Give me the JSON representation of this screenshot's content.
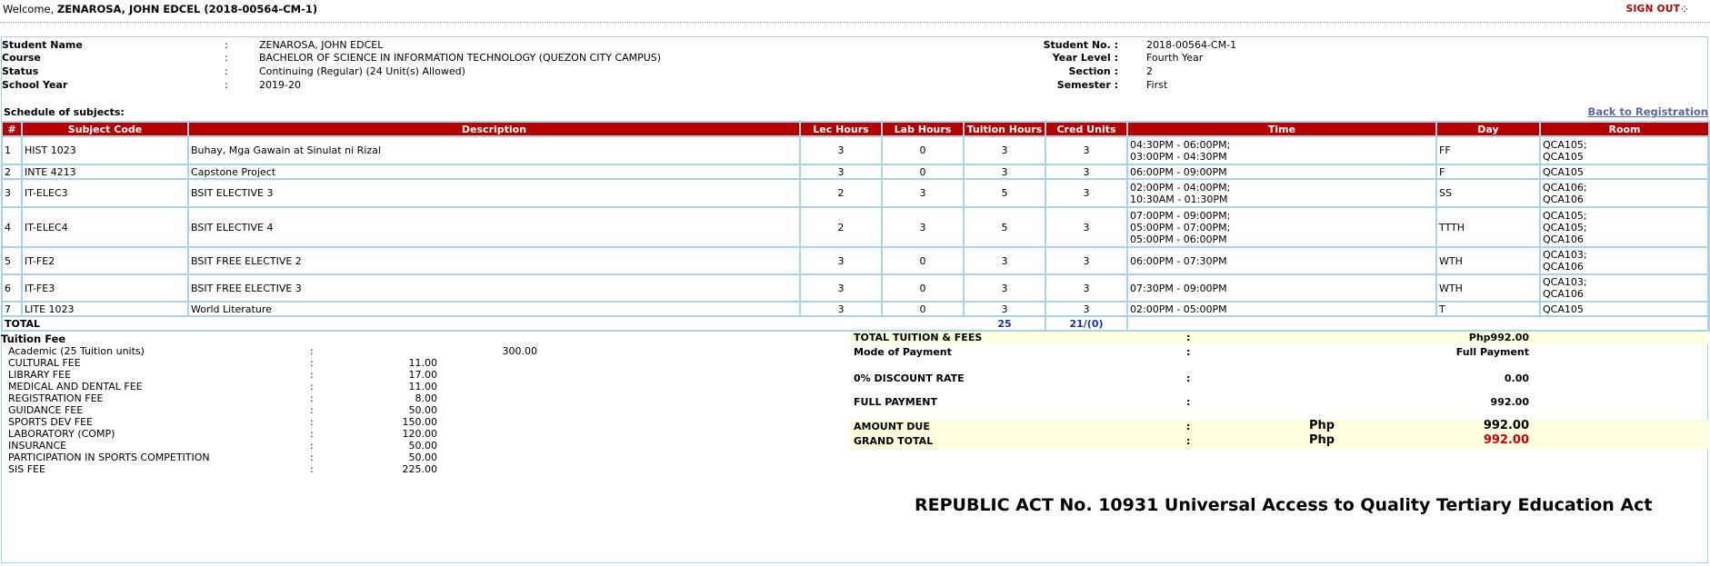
{
  "header": {
    "welcome_prefix": "Welcome, ",
    "welcome_user": "ZENAROSA, JOHN EDCEL (2018-00564-CM-1)",
    "signout_label": "SIGN OUT"
  },
  "student": {
    "left": [
      {
        "label": "Student Name",
        "value": "ZENAROSA, JOHN EDCEL"
      },
      {
        "label": "Course",
        "value": "BACHELOR OF SCIENCE IN INFORMATION TECHNOLOGY (QUEZON CITY CAMPUS)"
      },
      {
        "label": "Status",
        "value": "Continuing (Regular) (24 Unit(s) Allowed)"
      },
      {
        "label": "School Year",
        "value": "2019-20"
      }
    ],
    "right": [
      {
        "label": "Student No. :",
        "value": "2018-00564-CM-1"
      },
      {
        "label": "Year Level :",
        "value": "Fourth Year"
      },
      {
        "label": "Section :",
        "value": "2"
      },
      {
        "label": "Semester :",
        "value": "First"
      }
    ],
    "colon": ":"
  },
  "schedule": {
    "label": "Schedule of subjects:",
    "back_link": "Back to Registration",
    "headers": [
      "#",
      "Subject Code",
      "Description",
      "Lec Hours",
      "Lab Hours",
      "Tuition Hours",
      "Cred Units",
      "Time",
      "Day",
      "Room"
    ],
    "rows": [
      {
        "num": "1",
        "code": "HIST 1023",
        "desc": "Buhay, Mga Gawain at Sinulat ni Rizal",
        "lec": "3",
        "lab": "0",
        "tuition": "3",
        "cred": "3",
        "time": "04:30PM - 06:00PM;\n03:00PM - 04:30PM",
        "day": "FF",
        "room": "QCA105;\nQCA105"
      },
      {
        "num": "2",
        "code": "INTE 4213",
        "desc": "Capstone Project",
        "lec": "3",
        "lab": "0",
        "tuition": "3",
        "cred": "3",
        "time": "06:00PM - 09:00PM",
        "day": "F",
        "room": "QCA105"
      },
      {
        "num": "3",
        "code": "IT-ELEC3",
        "desc": "BSIT ELECTIVE 3",
        "lec": "2",
        "lab": "3",
        "tuition": "5",
        "cred": "3",
        "time": "02:00PM - 04:00PM;\n10:30AM - 01:30PM",
        "day": "SS",
        "room": "QCA106;\nQCA106"
      },
      {
        "num": "4",
        "code": "IT-ELEC4",
        "desc": "BSIT ELECTIVE 4",
        "lec": "2",
        "lab": "3",
        "tuition": "5",
        "cred": "3",
        "time": "07:00PM - 09:00PM;\n05:00PM - 07:00PM;\n05:00PM - 06:00PM",
        "day": "TTTH",
        "room": "QCA105;\nQCA105;\nQCA106"
      },
      {
        "num": "5",
        "code": "IT-FE2",
        "desc": "BSIT FREE ELECTIVE 2",
        "lec": "3",
        "lab": "0",
        "tuition": "3",
        "cred": "3",
        "time": "06:00PM - 07:30PM",
        "day": "WTH",
        "room": "QCA103;\nQCA106"
      },
      {
        "num": "6",
        "code": "IT-FE3",
        "desc": "BSIT FREE ELECTIVE 3",
        "lec": "3",
        "lab": "0",
        "tuition": "3",
        "cred": "3",
        "time": "07:30PM - 09:00PM",
        "day": "WTH",
        "room": "QCA103;\nQCA106"
      },
      {
        "num": "7",
        "code": "LITE 1023",
        "desc": "World Literature",
        "lec": "3",
        "lab": "0",
        "tuition": "3",
        "cred": "3",
        "time": "02:00PM - 05:00PM",
        "day": "T",
        "room": "QCA105"
      }
    ],
    "total_label": "TOTAL",
    "total_tuition": "25",
    "total_cred": "21/(0)"
  },
  "fees": {
    "title": "Tuition Fee",
    "colon": ":",
    "items": [
      {
        "name": "Academic (25 Tuition units)",
        "value": "300.00"
      },
      {
        "name": "CULTURAL FEE",
        "value": "11.00"
      },
      {
        "name": "LIBRARY FEE",
        "value": "17.00"
      },
      {
        "name": "MEDICAL AND DENTAL FEE",
        "value": "11.00"
      },
      {
        "name": "REGISTRATION FEE",
        "value": "8.00"
      },
      {
        "name": "GUIDANCE FEE",
        "value": "50.00"
      },
      {
        "name": "SPORTS DEV FEE",
        "value": "150.00"
      },
      {
        "name": "LABORATORY (COMP)",
        "value": "120.00"
      },
      {
        "name": "INSURANCE",
        "value": "50.00"
      },
      {
        "name": "PARTICIPATION IN SPORTS COMPETITION",
        "value": "50.00"
      },
      {
        "name": "SIS FEE",
        "value": "225.00"
      }
    ]
  },
  "summary": {
    "colon": ":",
    "total_tuition_label": "TOTAL TUITION & FEES",
    "total_tuition_value": "Php992.00",
    "mode_label": "Mode of Payment",
    "mode_value": "Full Payment",
    "discount_label": "0% DISCOUNT RATE",
    "discount_value": "0.00",
    "full_payment_label": "FULL PAYMENT",
    "full_payment_value": "992.00",
    "amount_due_label": "AMOUNT DUE",
    "amount_due_currency": "Php",
    "amount_due_value": "992.00",
    "grand_total_label": "GRAND TOTAL",
    "grand_total_currency": "Php",
    "grand_total_value": "992.00"
  },
  "footer": {
    "republic_act": "REPUBLIC ACT No. 10931 Universal Access to Quality Tertiary Education Act"
  },
  "colors": {
    "header_red": "#b50000",
    "border_blue": "#a9d4e6",
    "total_blue": "#1f2fa3",
    "grand_total_red": "#cc0000",
    "highlight": "#ffffe0"
  }
}
